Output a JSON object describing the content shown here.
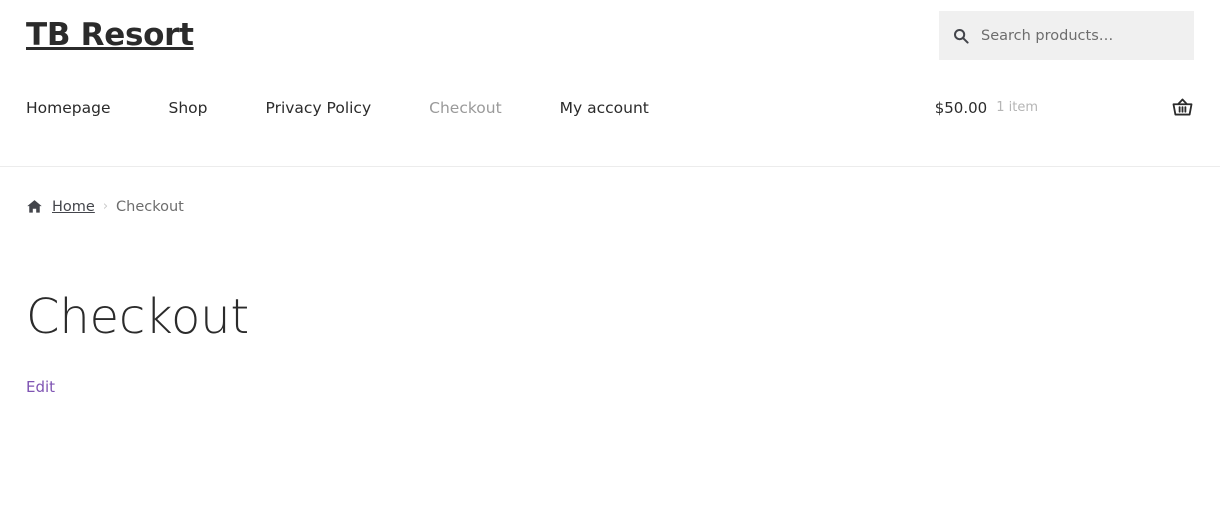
{
  "header": {
    "site_title": "TB Resort",
    "search": {
      "icon": "search-icon",
      "placeholder": "Search products…",
      "value": ""
    },
    "nav": [
      {
        "label": "Homepage",
        "current": false
      },
      {
        "label": "Shop",
        "current": false
      },
      {
        "label": "Privacy Policy",
        "current": false
      },
      {
        "label": "Checkout",
        "current": true
      },
      {
        "label": "My account",
        "current": false
      }
    ],
    "cart": {
      "amount": "$50.00",
      "count": "1 item",
      "icon": "shopping-basket-icon"
    }
  },
  "breadcrumb": {
    "home_icon": "home-icon",
    "home_label": "Home",
    "separator": "›",
    "current": "Checkout"
  },
  "main": {
    "page_title": "Checkout",
    "edit_link": "Edit"
  },
  "colors": {
    "text": "#2b2b2b",
    "muted": "#6d6d6d",
    "link_accent": "#7f54b3",
    "search_bg": "#f0f0f0",
    "divider": "#ececec"
  }
}
